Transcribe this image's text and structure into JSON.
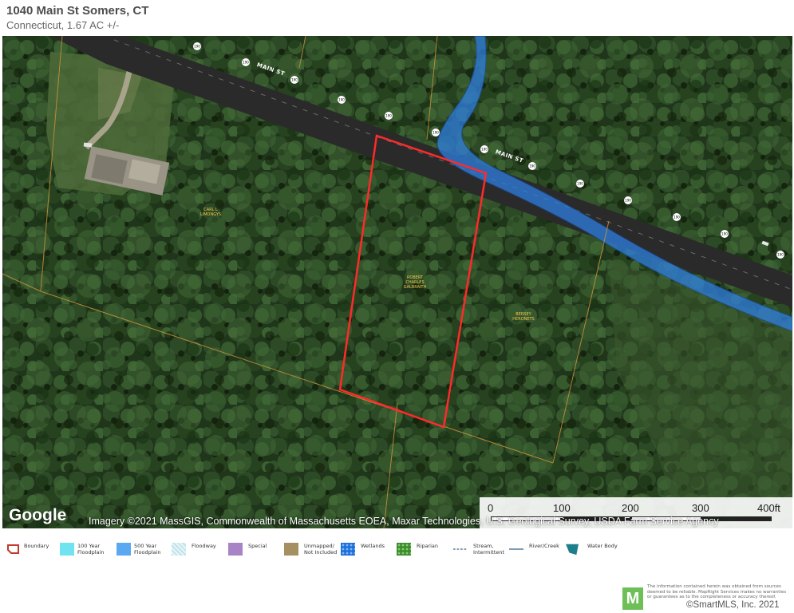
{
  "header": {
    "title": "1040 Main St Somers, CT",
    "subtitle": "Connecticut, 1.67 AC +/-"
  },
  "map": {
    "street_labels": [
      "MAIN ST",
      "MAIN ST"
    ],
    "route_shield_number": "190",
    "owner_labels": [
      "CARL L LIMONGYS",
      "ROBERT CHARLES GALBRAITH",
      "BERSEY HERONETS"
    ],
    "attribution": "Imagery ©2021 MassGIS, Commonwealth of Massachusetts EOEA, Maxar Technologies, U.S. Geological Survey, USDA Farm Service Agency",
    "google_logo": "Google",
    "scale": {
      "labels": [
        "0",
        "100",
        "200",
        "300",
        "400ft"
      ]
    },
    "colors": {
      "boundary": "#ff2a2a",
      "stream": "#2f7fe0",
      "parcel_lines": "#c9933a",
      "road": "#2b2b2b"
    }
  },
  "legend": [
    {
      "label": "Boundary",
      "color": "#c0392b",
      "icon": "boundary-icon"
    },
    {
      "label": "100 Year\nFloodplain",
      "color": "#6fe3f0",
      "icon": "swatch"
    },
    {
      "label": "500 Year\nFloodplain",
      "color": "#5aa9f0",
      "icon": "swatch"
    },
    {
      "label": "Floodway",
      "color": "#bfe3ea",
      "icon": "swatch"
    },
    {
      "label": "Special",
      "color": "#a884c6",
      "icon": "swatch"
    },
    {
      "label": "Unmapped/\nNot Included",
      "color": "#a69062",
      "icon": "swatch"
    },
    {
      "label": "Wetlands",
      "color": "#1f6fd8",
      "icon": "swatch"
    },
    {
      "label": "Riparian",
      "color": "#4a9a3a",
      "icon": "swatch"
    },
    {
      "label": "Stream,\nIntermittent",
      "color": "#3a5f8a",
      "icon": "dashed-line"
    },
    {
      "label": "River/Creek",
      "color": "#2f5f8a",
      "icon": "solid-line"
    },
    {
      "label": "Water Body",
      "color": "#1e7f8c",
      "icon": "water-body-icon"
    }
  ],
  "footer": {
    "logo_letter": "M",
    "disclaimer": "The information contained herein was obtained from sources deemed to be reliable. MapRight Services makes no warranties or guarantees as to the completeness or accuracy thereof.",
    "copyright": "©SmartMLS, Inc.  2021"
  }
}
